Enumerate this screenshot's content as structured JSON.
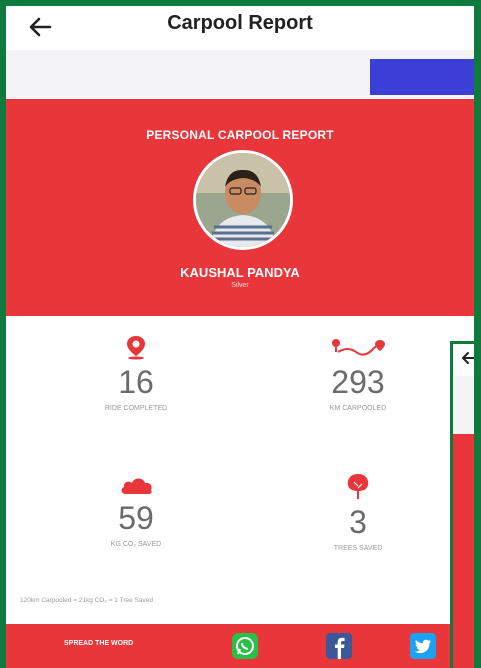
{
  "header": {
    "title": "Carpool Report",
    "back_icon": "arrow-left-icon"
  },
  "banner": {
    "title": "PERSONAL CARPOOL REPORT",
    "name": "KAUSHAL PANDYA",
    "subtitle": "Silver",
    "color": "#e8363b"
  },
  "stats": [
    {
      "icon": "map-pin-icon",
      "value": "16",
      "label": "RIDE COMPLETED"
    },
    {
      "icon": "route-icon",
      "value": "293",
      "label": "KM CARPOOLED"
    },
    {
      "icon": "cloud-icon",
      "value": "59",
      "label": "KG CO₂ SAVED"
    },
    {
      "icon": "tree-icon",
      "value": "3",
      "label": "TREES SAVED"
    }
  ],
  "summary": "120km Carpooled = 21kg CO₂ = 1 Tree Saved",
  "footer": {
    "spread_label": "SPREAD THE WORD",
    "share": [
      "whatsapp-icon",
      "facebook-icon",
      "twitter-icon"
    ]
  },
  "colors": {
    "accent": "#e8363b",
    "button": "#3b3fd6",
    "frame": "#0e7a3c"
  }
}
